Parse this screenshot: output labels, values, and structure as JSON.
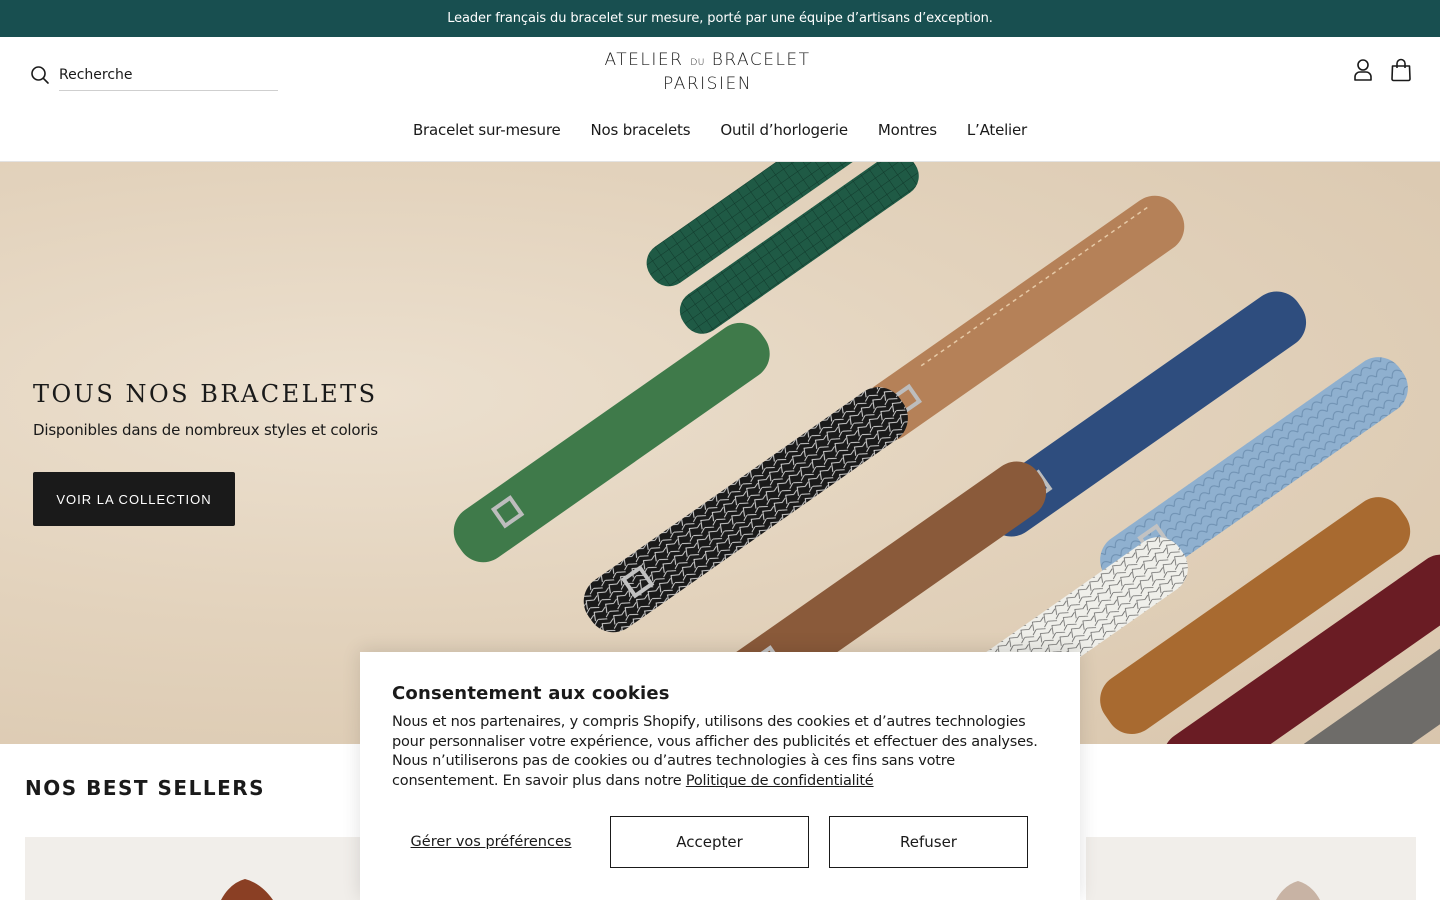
{
  "announcement": "Leader français du bracelet sur mesure, porté par une équipe d’artisans d’exception.",
  "header": {
    "search_placeholder": "Recherche",
    "logo_line1_a": "ATELIER",
    "logo_line1_du": "DU",
    "logo_line1_b": "BRACELET",
    "logo_line2": "PARISIEN",
    "icons": [
      "search-icon",
      "account-icon",
      "cart-icon"
    ]
  },
  "nav": {
    "items": [
      "Bracelet sur-mesure",
      "Nos bracelets",
      "Outil d’horlogerie",
      "Montres",
      "L’Atelier"
    ]
  },
  "hero": {
    "title": "TOUS NOS BRACELETS",
    "subtitle": "Disponibles dans de nombreux styles et coloris",
    "button": "VOIR LA COLLECTION"
  },
  "best_sellers": {
    "title": "NOS BEST SELLERS"
  },
  "cookie": {
    "title": "Consentement aux cookies",
    "text": "Nous et nos partenaires, y compris Shopify, utilisons des cookies et d’autres technologies pour personnaliser votre expérience, vous afficher des publicités et effectuer des analyses. Nous n’utiliserons pas de cookies ou d’autres technologies à ces fins sans votre consentement. En savoir plus dans notre",
    "link": "Politique de confidentialité",
    "preferences": "Gérer vos préférences",
    "accept": "Accepter",
    "refuse": "Refuser"
  },
  "colors": {
    "announcement_bg": "#184f50",
    "button_dark": "#1a1a1a",
    "hero_bg": "#e3d3bd"
  }
}
